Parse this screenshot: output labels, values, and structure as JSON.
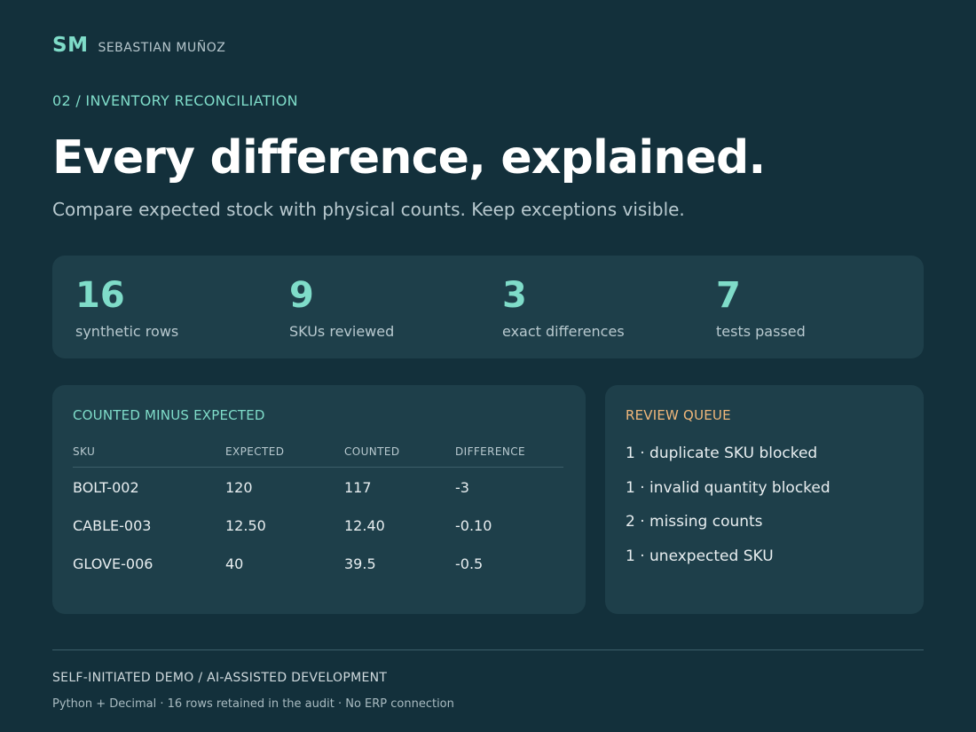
{
  "brand": {
    "mark": "SM",
    "name": "SEBASTIAN MUÑOZ"
  },
  "section_label": "02 / INVENTORY RECONCILIATION",
  "headline": "Every difference, explained.",
  "subhead": "Compare expected stock with physical counts. Keep exceptions visible.",
  "stats": [
    {
      "value": "16",
      "label": "synthetic rows"
    },
    {
      "value": "9",
      "label": "SKUs reviewed"
    },
    {
      "value": "3",
      "label": "exact differences"
    },
    {
      "value": "7",
      "label": "tests passed"
    }
  ],
  "diff_table": {
    "title": "COUNTED MINUS EXPECTED",
    "columns": [
      "SKU",
      "EXPECTED",
      "COUNTED",
      "DIFFERENCE"
    ],
    "rows": [
      [
        "BOLT-002",
        "120",
        "117",
        "-3"
      ],
      [
        "CABLE-003",
        "12.50",
        "12.40",
        "-0.10"
      ],
      [
        "GLOVE-006",
        "40",
        "39.5",
        "-0.5"
      ]
    ]
  },
  "review_queue": {
    "title": "REVIEW QUEUE",
    "items": [
      "1 · duplicate SKU blocked",
      "1 · invalid quantity blocked",
      "2 · missing counts",
      "1 · unexpected SKU"
    ]
  },
  "footer": {
    "title": "SELF-INITIATED DEMO / AI-ASSISTED DEVELOPMENT",
    "note": "Python + Decimal · 16 rows retained in the audit · No ERP connection"
  },
  "colors": {
    "background": "#13303b",
    "panel": "#1e3f4a",
    "accent_teal": "#7fdcc9",
    "accent_orange": "#f0b77a"
  }
}
